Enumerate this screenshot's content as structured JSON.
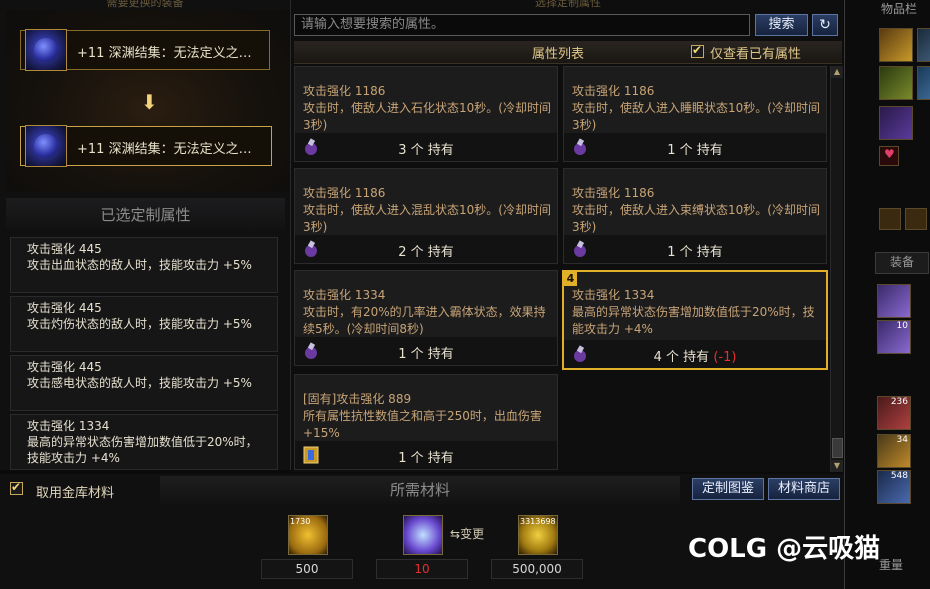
{
  "left_panel": {
    "top_caption": "需要更换的装备",
    "source_item": {
      "level": "+11",
      "name": "深渊结集：无法定义之…"
    },
    "target_item": {
      "level": "+11",
      "name": "深渊结集：无法定义之…"
    },
    "selected_header": "已选定制属性",
    "selected_attrs": [
      {
        "name": "攻击强化 445",
        "desc": "攻击出血状态的敌人时，技能攻击力 +5%"
      },
      {
        "name": "攻击强化 445",
        "desc": "攻击灼伤状态的敌人时，技能攻击力 +5%"
      },
      {
        "name": "攻击强化 445",
        "desc": "攻击感电状态的敌人时，技能攻击力 +5%"
      },
      {
        "name": "攻击强化 1334",
        "desc": "最高的异常状态伤害增加数值低于20%时，技能攻击力 +4%"
      }
    ]
  },
  "top_caption_mid": "选择定制属性",
  "search": {
    "placeholder": "请输入想要搜索的属性。",
    "button": "搜索",
    "refresh_icon": "↻"
  },
  "list_header": {
    "title": "属性列表",
    "only_have": "仅查看已有属性"
  },
  "cards": [
    {
      "name": "攻击强化 1186",
      "desc": "攻击时，使敌人进入石化状态10秒。(冷却时间3秒)",
      "count": "3",
      "unit": "个",
      "own": "持有",
      "delta": ""
    },
    {
      "name": "攻击强化 1186",
      "desc": "攻击时，使敌人进入睡眠状态10秒。(冷却时间3秒)",
      "count": "1",
      "unit": "个",
      "own": "持有",
      "delta": ""
    },
    {
      "name": "攻击强化 1186",
      "desc": "攻击时，使敌人进入混乱状态10秒。(冷却时间3秒)",
      "count": "2",
      "unit": "个",
      "own": "持有",
      "delta": ""
    },
    {
      "name": "攻击强化 1186",
      "desc": "攻击时，使敌人进入束缚状态10秒。(冷却时间3秒)",
      "count": "1",
      "unit": "个",
      "own": "持有",
      "delta": ""
    },
    {
      "name": "攻击强化 1334",
      "desc": "攻击时，有20%的几率进入霸体状态，效果持续5秒。(冷却时间8秒)",
      "count": "1",
      "unit": "个",
      "own": "持有",
      "delta": ""
    },
    {
      "name": "攻击强化 1334",
      "desc": "最高的异常状态伤害增加数值低于20%时，技能攻击力 +4%",
      "count": "4",
      "unit": "个",
      "own": "持有",
      "delta": "(-1)",
      "badge": "4"
    },
    {
      "name": "[固有]攻击强化 889",
      "desc": "所有属性抗性数值之和高于250时，出血伤害 +15%",
      "count": "1",
      "unit": "个",
      "own": "持有",
      "delta": ""
    }
  ],
  "bottom": {
    "use_gold_label": "取用金库材料",
    "need_header": "所需材料",
    "btn_atlas": "定制图鉴",
    "btn_shop": "材料商店",
    "change_label": "变更",
    "materials": [
      {
        "stack": "1730",
        "value": "500",
        "color": "#d8d8d8"
      },
      {
        "stack": "",
        "value": "10",
        "color": "#e03030"
      },
      {
        "stack": "3313698",
        "value": "500,000",
        "color": "#d8d8d8"
      }
    ]
  },
  "right_strip": {
    "header": "物品栏",
    "equip_label": "装备",
    "counts": [
      "10",
      "236",
      "34",
      "548"
    ],
    "bottom_text": "重量"
  },
  "watermark": "COLG @云吸猫",
  "colors": {
    "gold": "#e0b028",
    "blue_btn": "#2b3e64",
    "red": "#e03030",
    "text": "#c8a476"
  }
}
